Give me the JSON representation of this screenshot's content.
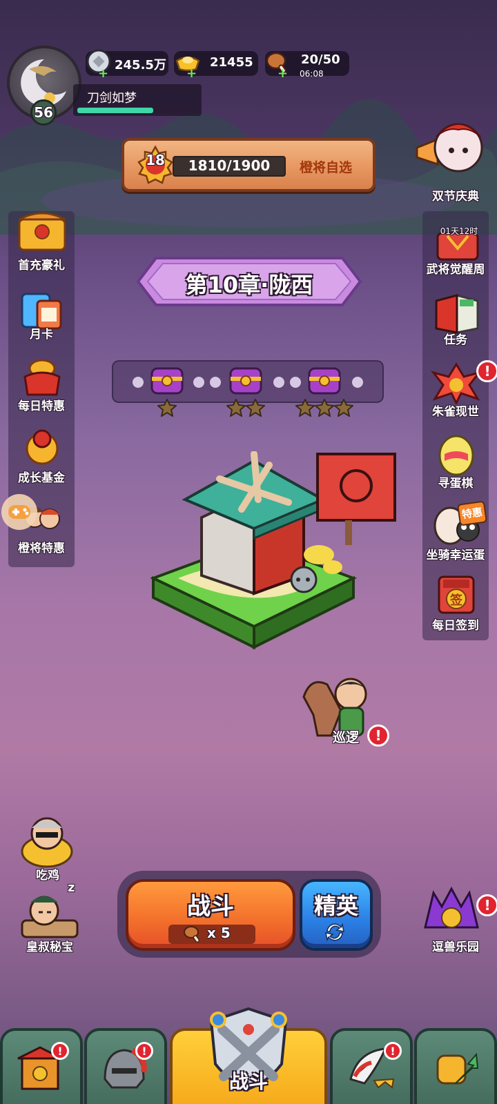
{
  "player": {
    "name": "刀剑如梦",
    "level": "56"
  },
  "resources": {
    "silver": "245.5万",
    "gold": "21455",
    "stamina": "20/50",
    "stamina_timer": "06:08"
  },
  "banner": {
    "level": "18",
    "progress_text": "1810/1900",
    "action_label": "橙将自选",
    "progress": 0.953
  },
  "chapter": {
    "title": "第10章·陇西"
  },
  "left_menu": [
    {
      "label": "首充豪礼",
      "icon": "treasure-chest-icon"
    },
    {
      "label": "月卡",
      "icon": "calendar-card-icon"
    },
    {
      "label": "每日特惠",
      "icon": "gift-bag-icon"
    },
    {
      "label": "成长基金",
      "icon": "money-bag-icon"
    },
    {
      "label": "橙将特惠",
      "icon": "hero-group-icon"
    }
  ],
  "right_menu": [
    {
      "label": "双节庆典",
      "icon": "festival-hero-icon"
    },
    {
      "label": "武将觉醒周",
      "icon": "awaken-icon",
      "timer": "01天12时"
    },
    {
      "label": "任务",
      "icon": "task-book-icon"
    },
    {
      "label": "朱雀现世",
      "icon": "phoenix-icon",
      "alert": "!"
    },
    {
      "label": "寻蛋棋",
      "icon": "egg-icon"
    },
    {
      "label": "坐骑幸运蛋",
      "icon": "mount-egg-icon",
      "tag": "特惠"
    },
    {
      "label": "每日签到",
      "icon": "sign-in-icon",
      "stamp": "签"
    }
  ],
  "patrol": {
    "label": "巡逻",
    "alert": "!"
  },
  "bottom_left": [
    {
      "label": "吃鸡",
      "icon": "chicken-hero-icon"
    },
    {
      "label": "皇叔秘宝",
      "icon": "sleeping-uncle-icon",
      "z": "z"
    }
  ],
  "bottom_right": {
    "label": "逗兽乐园",
    "icon": "beast-park-icon",
    "alert": "!"
  },
  "battle": {
    "label": "战斗",
    "cost": "x 5",
    "elite_label": "精英"
  },
  "nav": {
    "active_label": "战斗",
    "tabs": [
      {
        "name": "city",
        "alert": "!"
      },
      {
        "name": "heroes",
        "alert": "!"
      },
      {
        "name": "battle"
      },
      {
        "name": "equipment",
        "alert": "!"
      },
      {
        "name": "growth"
      }
    ]
  },
  "colors": {
    "alert": "#e12430",
    "battle": "#f4722c",
    "elite": "#2b7ee3",
    "active_tab": "#ffcf3a"
  }
}
